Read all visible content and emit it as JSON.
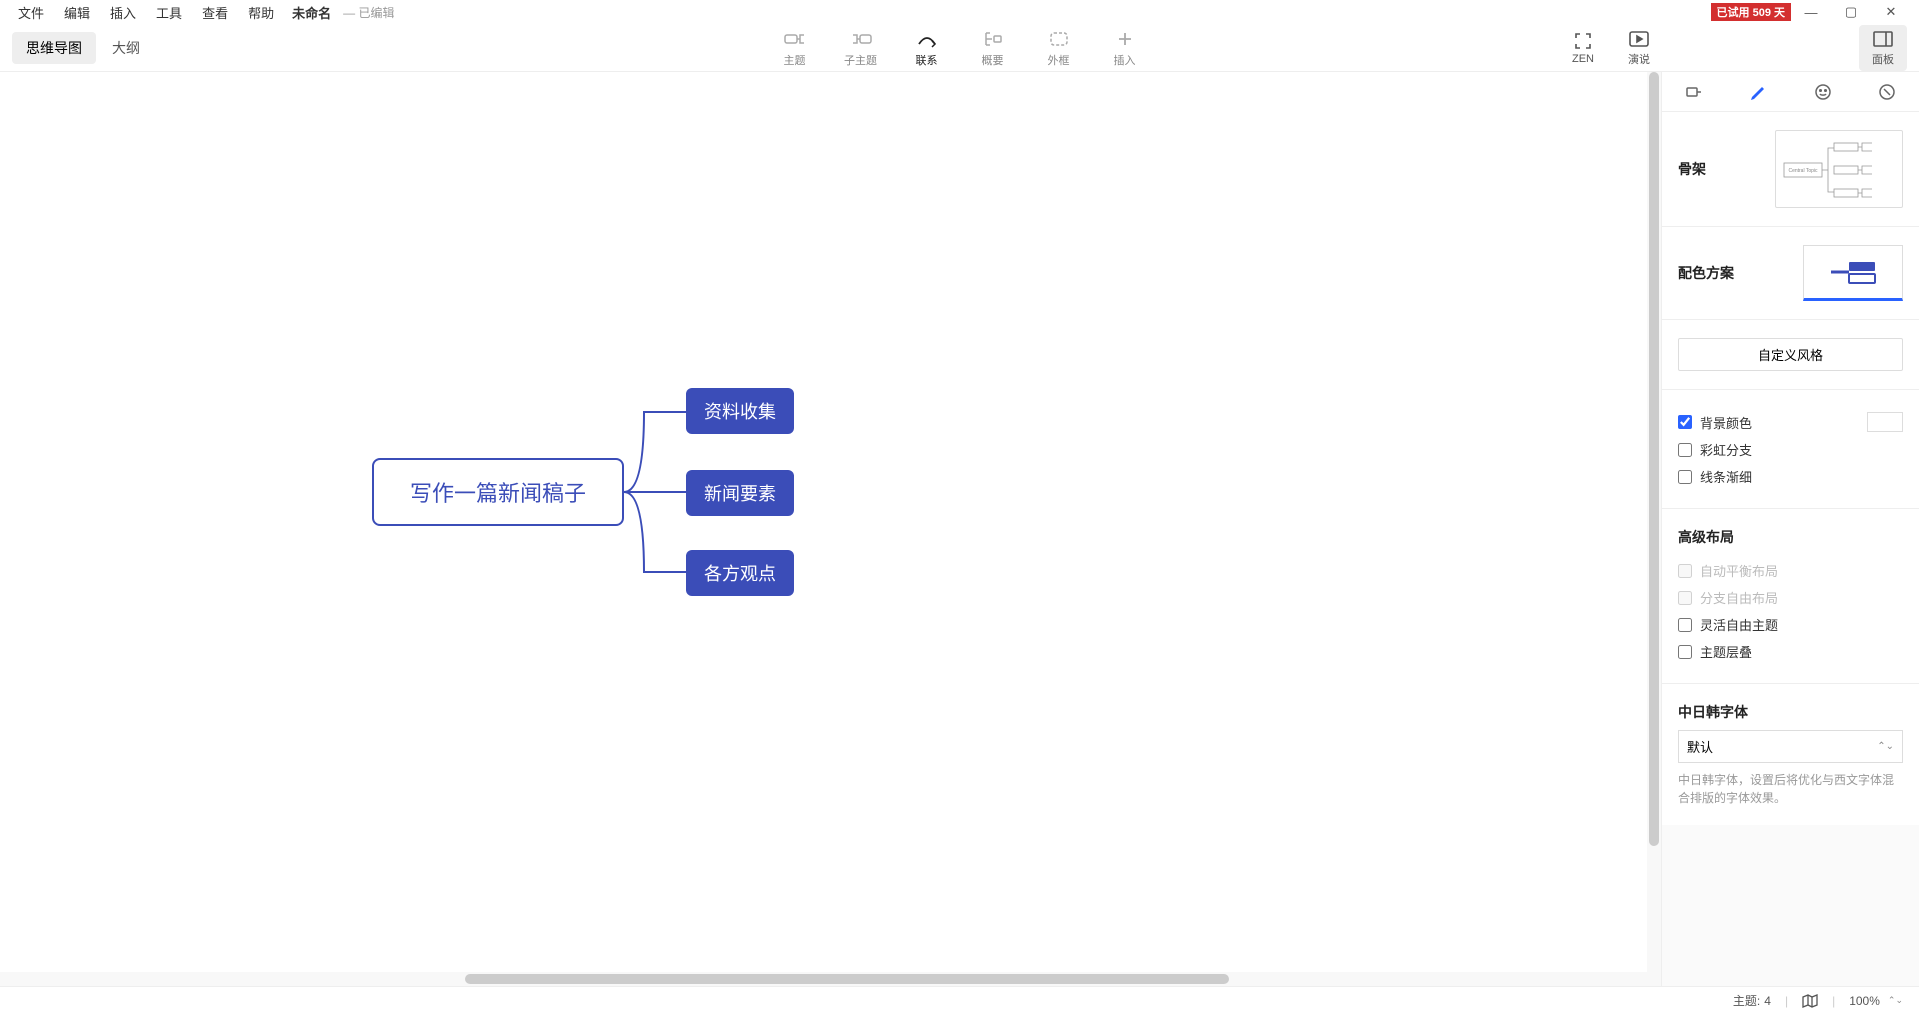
{
  "menubar": {
    "items": [
      "文件",
      "编辑",
      "插入",
      "工具",
      "查看",
      "帮助"
    ],
    "doc_title": "未命名",
    "doc_status": "— 已编辑",
    "trial_badge": "已试用 509 天"
  },
  "view_tabs": {
    "mindmap": "思维导图",
    "outline": "大纲"
  },
  "toolbar": {
    "topic": "主题",
    "subtopic": "子主题",
    "relationship": "联系",
    "summary": "概要",
    "boundary": "外框",
    "insert": "插入",
    "zen": "ZEN",
    "present": "演说",
    "panel": "面板"
  },
  "mindmap": {
    "central": "写作一篇新闻稿子",
    "topics": [
      "资料收集",
      "新闻要素",
      "各方观点"
    ]
  },
  "panel": {
    "skeleton_label": "骨架",
    "skeleton_thumb_text": "Central Topic",
    "scheme_label": "配色方案",
    "custom_style": "自定义风格",
    "bg_color": "背景颜色",
    "rainbow": "彩虹分支",
    "tapered": "线条渐细",
    "adv_layout": "高级布局",
    "auto_balance": "自动平衡布局",
    "free_branch": "分支自由布局",
    "free_topic": "灵活自由主题",
    "overlap": "主题层叠",
    "cjk_font": "中日韩字体",
    "font_default": "默认",
    "font_hint": "中日韩字体，设置后将优化与西文字体混合排版的字体效果。"
  },
  "statusbar": {
    "topics_label": "主题:",
    "topics_count": "4",
    "zoom": "100%"
  }
}
